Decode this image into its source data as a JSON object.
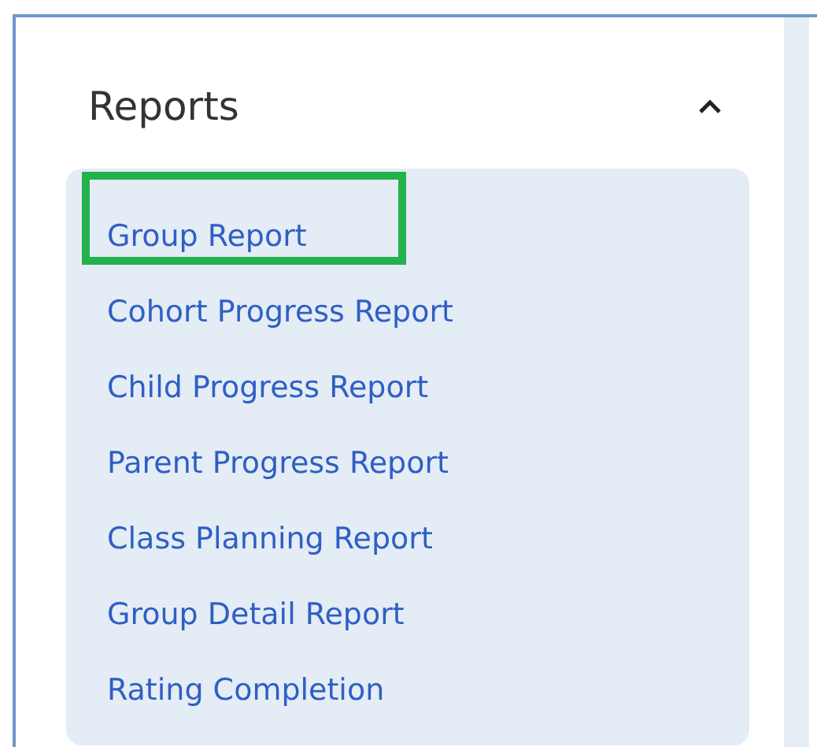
{
  "section": {
    "title": "Reports",
    "expanded": true,
    "items": [
      {
        "label": "Group Report",
        "highlighted": true
      },
      {
        "label": "Cohort Progress Report",
        "highlighted": false
      },
      {
        "label": "Child Progress Report",
        "highlighted": false
      },
      {
        "label": "Parent Progress Report",
        "highlighted": false
      },
      {
        "label": "Class Planning Report",
        "highlighted": false
      },
      {
        "label": "Group Detail Report",
        "highlighted": false
      },
      {
        "label": "Rating Completion",
        "highlighted": false
      }
    ]
  }
}
